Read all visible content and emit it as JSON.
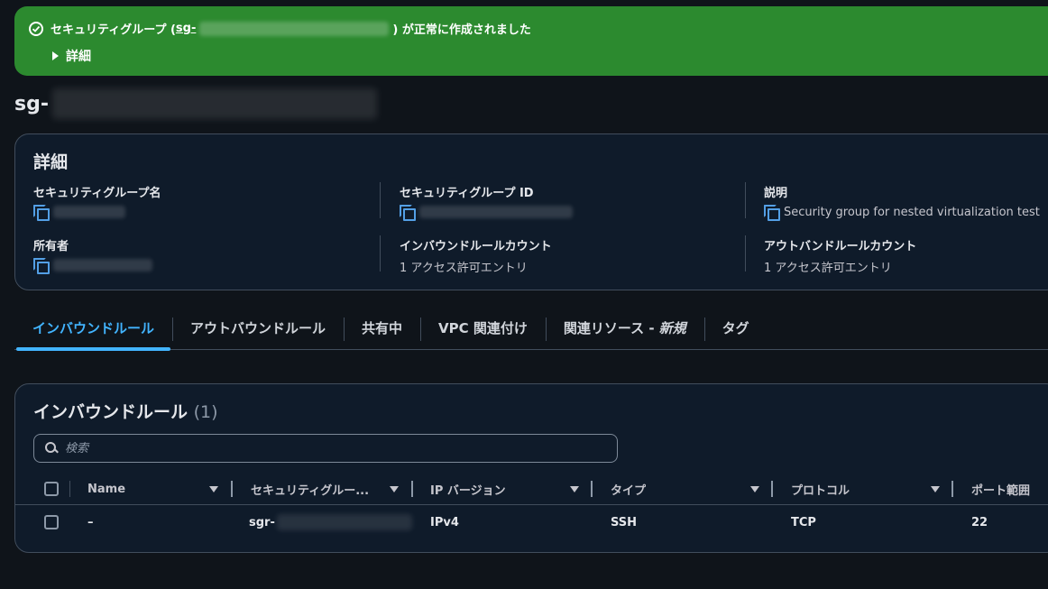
{
  "flash": {
    "message_prefix": "セキュリティグループ (",
    "sg_id": "sg-",
    "message_suffix": ") が正常に作成されました",
    "details_label": "詳細",
    "status_color": "#2c8a2f"
  },
  "page_title": "sg-",
  "details": {
    "heading": "詳細",
    "sg_name_label": "セキュリティグループ名",
    "sg_id_label": "セキュリティグループ ID",
    "description_label": "説明",
    "description_value": "Security group for nested virtualization test",
    "owner_label": "所有者",
    "inbound_count_label": "インバウンドルールカウント",
    "inbound_count_value": "1 アクセス許可エントリ",
    "outbound_count_label": "アウトバンドルールカウント",
    "outbound_count_value": "1 アクセス許可エントリ"
  },
  "tabs": {
    "inbound": "インバウンドルール",
    "outbound": "アウトバウンドルール",
    "sharing": "共有中",
    "vpc": "VPC 関連付け",
    "related_prefix": "関連リソース -",
    "related_new": "新規",
    "tags": "タグ"
  },
  "inbound_rules": {
    "title": "インバウンドルール",
    "count": "(1)",
    "search_placeholder": "検索",
    "columns": {
      "name": "Name",
      "sg_rule": "セキュリティグルー...",
      "ip_version": "IP バージョン",
      "type": "タイプ",
      "protocol": "プロトコル",
      "port_range": "ポート範囲"
    },
    "rows": [
      {
        "name": "–",
        "sg_rule": "sgr-",
        "ip_version": "IPv4",
        "type": "SSH",
        "protocol": "TCP",
        "port_range": "22"
      }
    ]
  },
  "accent_color": "#42b4ff"
}
